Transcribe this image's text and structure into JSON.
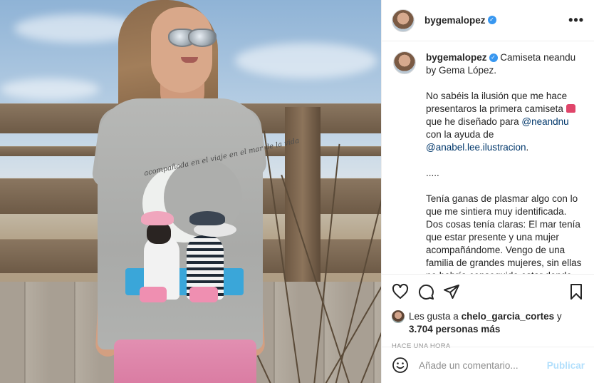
{
  "post": {
    "username": "bygemalopez",
    "verified_symbol": "✓",
    "more_symbol": "•••"
  },
  "caption": {
    "username": "bygemalopez",
    "title": "Camiseta neandu by Gema López.",
    "p1_a": "No sabéis la ilusión que me hace presentaros la primera camiseta",
    "p1_b": "que he diseñado para",
    "p1_mention1": "@neandnu",
    "p1_c": "con la ayuda de",
    "p1_mention2": "@anabel.lee.ilustracion",
    "p1_d": ".",
    "p2": ".....",
    "p3": "Tenía ganas de plasmar algo con lo que me sintiera muy identificada. Dos cosas tenía claras: El mar tenía que estar presente y una mujer acompañándome. Vengo de una familia de grandes mujeres, sin ellas no habría conseguido estar donde estoy y ser lo que soy y con esas dos premisas me lancé a esta aventura."
  },
  "likes": {
    "prefix": "Les gusta a",
    "liker": "chelo_garcia_cortes",
    "connector": "y",
    "count": "3.704 personas más"
  },
  "timestamp": "HACE UNA HORA",
  "comment_box": {
    "placeholder": "Añade un comentario...",
    "publish_label": "Publicar"
  },
  "photo": {
    "shirt_script": "acompañada en el viaje en el mar de la vida"
  },
  "colors": {
    "link": "#00376b",
    "verified": "#3897f0",
    "publish_disabled": "#b2dffc",
    "muted": "#8e8e8e"
  }
}
